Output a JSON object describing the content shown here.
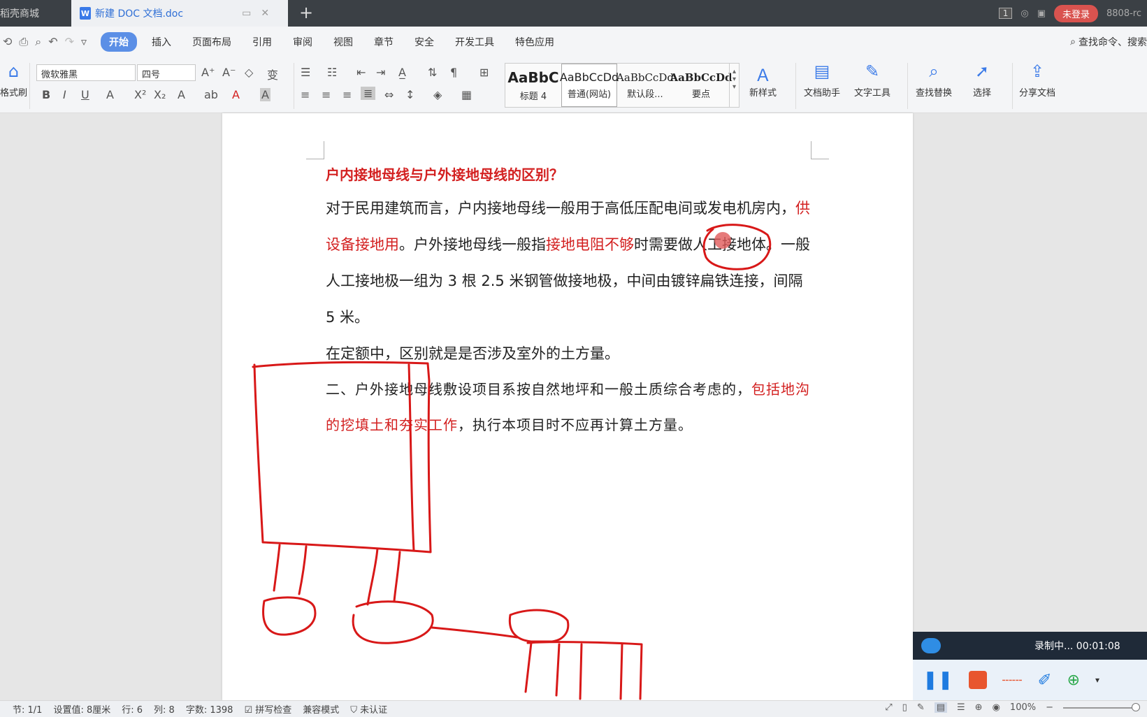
{
  "tabs": {
    "inactive_label": "稻壳商城",
    "active_label": "新建 DOC 文档.doc",
    "doc_icon": "W",
    "new_tab": "+"
  },
  "top_right": {
    "window_count": "1",
    "login_label": "未登录",
    "user_text": "8808-rc"
  },
  "menu": {
    "items": [
      "开始",
      "插入",
      "页面布局",
      "引用",
      "审阅",
      "视图",
      "章节",
      "安全",
      "开发工具",
      "特色应用"
    ],
    "search_label": "查找命令、搜索"
  },
  "ribbon": {
    "format_painter": "格式刷",
    "font_name": "微软雅黑",
    "font_size": "四号",
    "styles": [
      {
        "preview": "AaBbC",
        "name": "标题 4"
      },
      {
        "preview": "AaBbCcDd",
        "name": "普通(网站)"
      },
      {
        "preview": "AaBbCcDd",
        "name": "默认段..."
      },
      {
        "preview": "AaBbCcDd",
        "name": "要点"
      }
    ],
    "new_style": "新样式",
    "doc_assistant": "文档助手",
    "text_tools": "文字工具",
    "find_replace": "查找替换",
    "select": "选择",
    "share_doc": "分享文档"
  },
  "document": {
    "title": "户内接地母线与户外接地母线的区别？",
    "p1_a": "对于民用建筑而言，户内接地母线一般用于高低压配电间或发电机房内，",
    "p1_red1": "供设备接地用",
    "p1_b": "。户外接地母线一般指",
    "p1_red2": "接地电阻不够",
    "p1_c": "时需要做人工接地体。一般人工接地极一组为 3 根 2.5 米钢管做接地极，中间由镀锌扁铁连接，间隔 5 米。",
    "p2": "在定额中，区别就是是否涉及室外的土方量。",
    "p3_a": "二、户外接地母线敷设项目系按自然地坪和一般土质综合考虑的，",
    "p3_red": "包括地沟的挖填土和夯实工作",
    "p3_b": "，执行本项目时不应再计算土方量。"
  },
  "statusbar": {
    "section": "节: 1/1",
    "setting": "设置值: 8厘米",
    "row": "行: 6",
    "col": "列: 8",
    "word_count": "字数: 1398",
    "spell_check": "拼写检查",
    "compat_mode": "兼容模式",
    "unverified": "未认证",
    "zoom": "100%"
  },
  "recorder": {
    "status": "录制中... 00:01:08"
  },
  "colors": {
    "accent": "#3a7ae8",
    "annotation_red": "#d81818",
    "doc_red": "#d32020"
  }
}
